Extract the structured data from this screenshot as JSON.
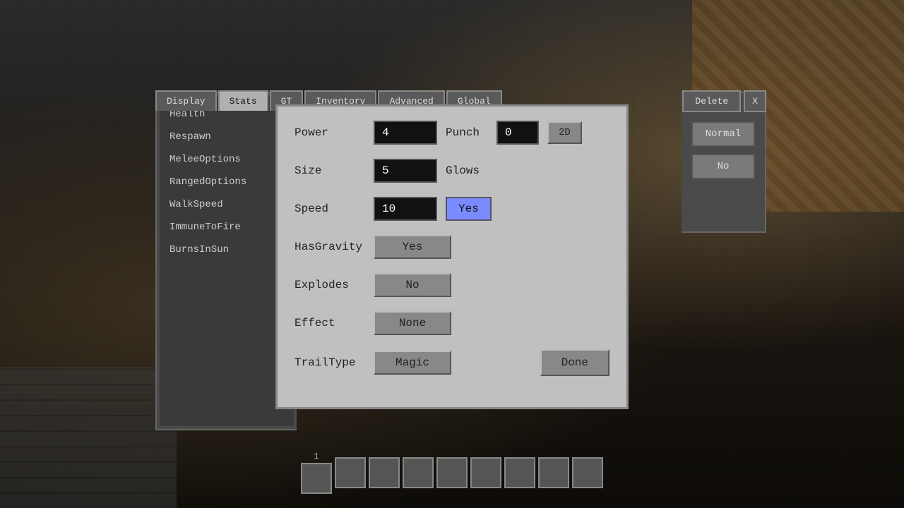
{
  "background": {
    "color": "#1a1a1a"
  },
  "tabs": {
    "items": [
      {
        "label": "Display",
        "active": false
      },
      {
        "label": "Stats",
        "active": true
      },
      {
        "label": "GT",
        "active": false
      },
      {
        "label": "Inventory",
        "active": false
      },
      {
        "label": "Advanced",
        "active": false
      },
      {
        "label": "Global",
        "active": false
      }
    ]
  },
  "top_right": {
    "delete_label": "Delete",
    "close_label": "X"
  },
  "left_panel": {
    "items": [
      {
        "label": "Health"
      },
      {
        "label": "Respawn"
      },
      {
        "label": "MeleeOptions"
      },
      {
        "label": "RangedOptions"
      },
      {
        "label": "WalkSpeed"
      },
      {
        "label": "ImmuneToFire"
      },
      {
        "label": "BurnsInSun"
      }
    ]
  },
  "right_panel": {
    "normal_label": "Normal",
    "no_label": "No"
  },
  "dialog": {
    "rows": [
      {
        "label": "Power",
        "input_value": "4",
        "extra_label": "Punch",
        "extra_input": "0",
        "extra_btn": "2D"
      },
      {
        "label": "Size",
        "input_value": "5",
        "extra_label": "Glows",
        "extra_btn": null
      },
      {
        "label": "Speed",
        "input_value": "10",
        "toggle_label": "Yes",
        "toggle_active": true
      },
      {
        "label": "HasGravity",
        "toggle_label": "Yes",
        "toggle_active": false
      },
      {
        "label": "Explodes",
        "toggle_label": "No",
        "toggle_active": false
      },
      {
        "label": "Effect",
        "toggle_label": "None",
        "toggle_active": false
      },
      {
        "label": "TrailType",
        "toggle_label": "Magic",
        "toggle_active": false,
        "done_label": "Done"
      }
    ]
  },
  "hotbar": {
    "number": "1",
    "slots": 9
  }
}
